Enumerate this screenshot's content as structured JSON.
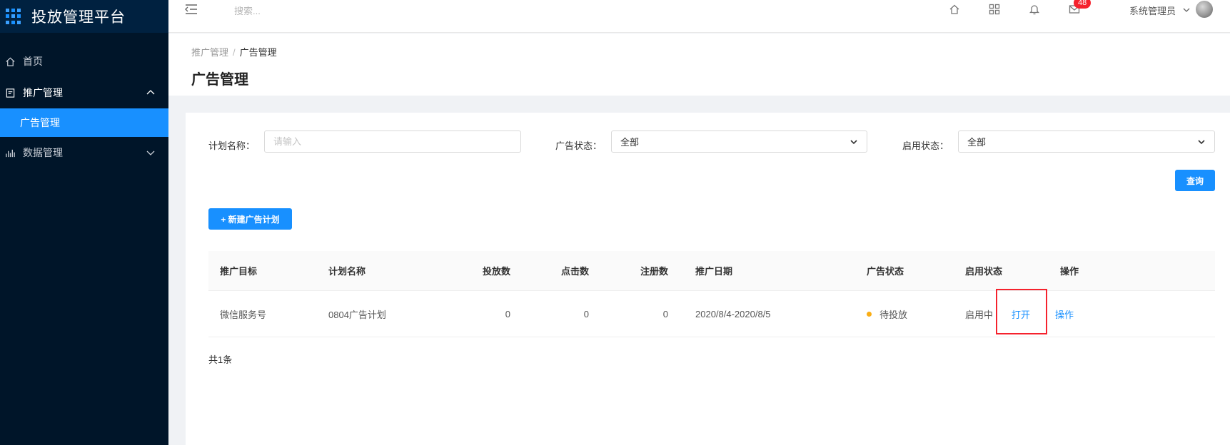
{
  "app": {
    "title": "投放管理平台"
  },
  "sidebar": {
    "items": [
      {
        "label": "首页",
        "icon": "home-icon"
      },
      {
        "label": "推广管理",
        "icon": "document-icon",
        "expanded": true,
        "children": [
          {
            "label": "广告管理",
            "active": true
          }
        ]
      },
      {
        "label": "数据管理",
        "icon": "bar-chart-icon",
        "expanded": false
      }
    ]
  },
  "header": {
    "search_placeholder": "搜索...",
    "notification_badge": "48",
    "user_name": "系统管理员"
  },
  "breadcrumb": {
    "parent": "推广管理",
    "separator": "/",
    "current": "广告管理"
  },
  "page_title": "广告管理",
  "filters": {
    "plan_name_label": "计划名称：",
    "plan_name_placeholder": "请输入",
    "ad_status_label": "广告状态：",
    "ad_status_value": "全部",
    "enable_status_label": "启用状态：",
    "enable_status_value": "全部",
    "query_button": "查询"
  },
  "new_plan_button": "+ 新建广告计划",
  "table": {
    "columns": [
      "推广目标",
      "计划名称",
      "投放数",
      "点击数",
      "注册数",
      "推广日期",
      "广告状态",
      "启用状态",
      "操作"
    ],
    "rows": [
      {
        "target": "微信服务号",
        "plan_name": "0804广告计划",
        "impressions": "0",
        "clicks": "0",
        "registrations": "0",
        "date_range": "2020/8/4-2020/8/5",
        "ad_status": "待投放",
        "enable_status": "启用中",
        "action_open": "打开",
        "action_more": "操作"
      }
    ]
  },
  "total_text": "共1条",
  "colors": {
    "sidebar_bg": "#001529",
    "accent": "#1890ff",
    "badge": "#f5222d",
    "status_pending": "#faad14",
    "highlight_box": "#f5222d"
  }
}
